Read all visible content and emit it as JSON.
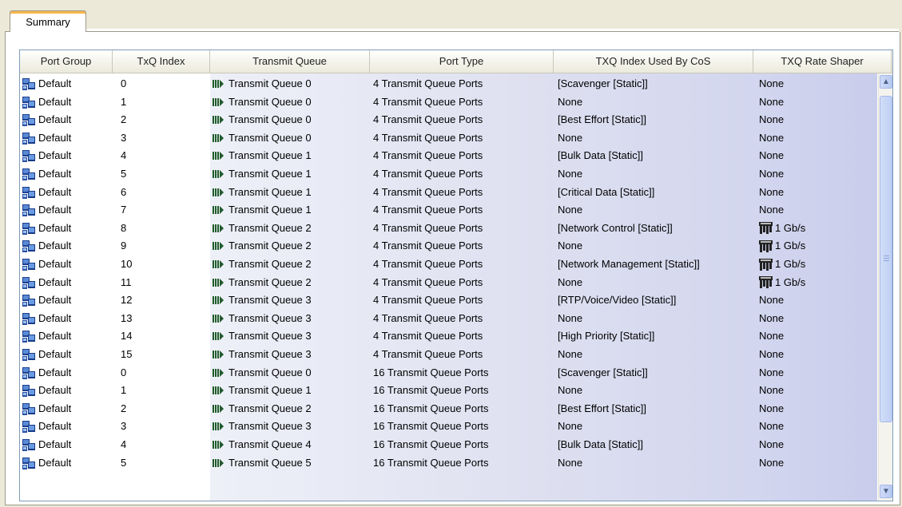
{
  "tabs": [
    {
      "label": "Summary"
    }
  ],
  "table": {
    "columns": [
      "Port Group",
      "TxQ Index",
      "Transmit Queue",
      "Port Type",
      "TXQ Index Used By CoS",
      "TXQ Rate Shaper"
    ],
    "rows": [
      [
        "Default",
        "0",
        "Transmit Queue 0",
        "4 Transmit Queue Ports",
        "[Scavenger [Static]]",
        "None"
      ],
      [
        "Default",
        "1",
        "Transmit Queue 0",
        "4 Transmit Queue Ports",
        "None",
        "None"
      ],
      [
        "Default",
        "2",
        "Transmit Queue 0",
        "4 Transmit Queue Ports",
        "[Best Effort [Static]]",
        "None"
      ],
      [
        "Default",
        "3",
        "Transmit Queue 0",
        "4 Transmit Queue Ports",
        "None",
        "None"
      ],
      [
        "Default",
        "4",
        "Transmit Queue 1",
        "4 Transmit Queue Ports",
        "[Bulk Data [Static]]",
        "None"
      ],
      [
        "Default",
        "5",
        "Transmit Queue 1",
        "4 Transmit Queue Ports",
        "None",
        "None"
      ],
      [
        "Default",
        "6",
        "Transmit Queue 1",
        "4 Transmit Queue Ports",
        "[Critical Data [Static]]",
        "None"
      ],
      [
        "Default",
        "7",
        "Transmit Queue 1",
        "4 Transmit Queue Ports",
        "None",
        "None"
      ],
      [
        "Default",
        "8",
        "Transmit Queue 2",
        "4 Transmit Queue Ports",
        "[Network Control [Static]]",
        "1 Gb/s"
      ],
      [
        "Default",
        "9",
        "Transmit Queue 2",
        "4 Transmit Queue Ports",
        "None",
        "1 Gb/s"
      ],
      [
        "Default",
        "10",
        "Transmit Queue 2",
        "4 Transmit Queue Ports",
        "[Network Management [Static]]",
        "1 Gb/s"
      ],
      [
        "Default",
        "11",
        "Transmit Queue 2",
        "4 Transmit Queue Ports",
        "None",
        "1 Gb/s"
      ],
      [
        "Default",
        "12",
        "Transmit Queue 3",
        "4 Transmit Queue Ports",
        "[RTP/Voice/Video [Static]]",
        "None"
      ],
      [
        "Default",
        "13",
        "Transmit Queue 3",
        "4 Transmit Queue Ports",
        "None",
        "None"
      ],
      [
        "Default",
        "14",
        "Transmit Queue 3",
        "4 Transmit Queue Ports",
        "[High Priority [Static]]",
        "None"
      ],
      [
        "Default",
        "15",
        "Transmit Queue 3",
        "4 Transmit Queue Ports",
        "None",
        "None"
      ],
      [
        "Default",
        "0",
        "Transmit Queue 0",
        "16 Transmit Queue Ports",
        "[Scavenger [Static]]",
        "None"
      ],
      [
        "Default",
        "1",
        "Transmit Queue 1",
        "16 Transmit Queue Ports",
        "None",
        "None"
      ],
      [
        "Default",
        "2",
        "Transmit Queue 2",
        "16 Transmit Queue Ports",
        "[Best Effort [Static]]",
        "None"
      ],
      [
        "Default",
        "3",
        "Transmit Queue 3",
        "16 Transmit Queue Ports",
        "None",
        "None"
      ],
      [
        "Default",
        "4",
        "Transmit Queue 4",
        "16 Transmit Queue Ports",
        "[Bulk Data [Static]]",
        "None"
      ],
      [
        "Default",
        "5",
        "Transmit Queue 5",
        "16 Transmit Queue Ports",
        "None",
        "None"
      ]
    ]
  },
  "icons": {
    "port_group": "port-group-icon",
    "transmit_queue": "transmit-queue-icon",
    "rate_shaper": "rate-shaper-icon"
  },
  "colors": {
    "border": "#7f9db9",
    "tab_accent": "#f7b54a",
    "scrollbar": "#b8c9f2"
  }
}
